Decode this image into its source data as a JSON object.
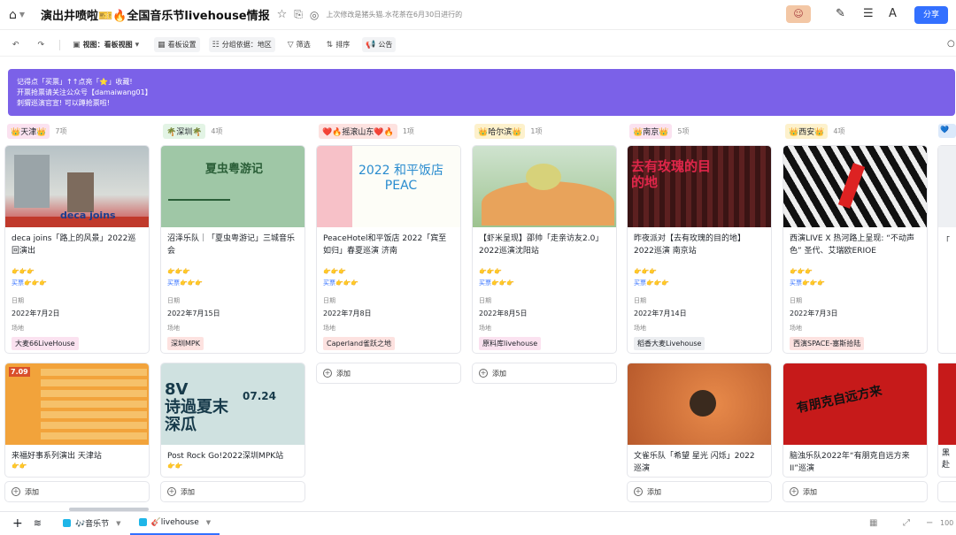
{
  "title_bar": {
    "doc_title": "演出井喷啦🎫🔥全国音乐节livehouse情报",
    "saved_text": "上次修改是猪头猫.水花茶在6月30日进行的",
    "share_label": "分享"
  },
  "toolbar": {
    "view_label": "视图：看板视图",
    "board_settings": "看板设置",
    "group_by": "分组依据：地区",
    "filter": "筛选",
    "sort": "排序",
    "notice": "公告"
  },
  "banner": {
    "lines": [
      "记得点「买票」↑↑点亮「⭐」收藏!",
      "开票抢票请关注公众号【damaiwang01】",
      "刺猬巡演官宣! 可以蹲抢票啦!"
    ]
  },
  "field_labels": {
    "date": "日期",
    "venue": "场地",
    "buy": "买票👉👉👉",
    "add": "添加"
  },
  "columns": [
    {
      "tag": "👑天津👑",
      "count": "7项",
      "tag_color": "#fbe2f0",
      "cards": [
        {
          "title": "deca joins「路上的风景」2022巡回演出",
          "date": "2022年7月2日",
          "venue": "大麦66LiveHouse",
          "venue_color": "#fbe2f0",
          "img": "deca joins"
        },
        {
          "title": "来福好事系列演出 天津站",
          "img": "7.09"
        }
      ]
    },
    {
      "tag": "🌴深圳🌴",
      "count": "4项",
      "tag_color": "#e3f4e5",
      "cards": [
        {
          "title": "沼泽乐队｜「夏虫粤游记」三城音乐会",
          "date": "2022年7月15日",
          "venue": "深圳MPK",
          "venue_color": "#fde2e0",
          "img": "夏虫粤游记"
        },
        {
          "title": "Post Rock Go!2022深圳MPK站",
          "img": "07.24"
        }
      ]
    },
    {
      "tag": "❤️🔥摇滚山东❤️🔥",
      "count": "1项",
      "tag_color": "#fde2e0",
      "cards": [
        {
          "title": "PeaceHotel和平饭店 2022「宾至如归」春夏巡演 济南",
          "date": "2022年7月8日",
          "venue": "Caperland雀跃之地",
          "venue_color": "#fde2e0",
          "img": "2022 和平饭店 PEAC"
        }
      ]
    },
    {
      "tag": "👑哈尔滨👑",
      "count": "1项",
      "tag_color": "#fdf1cc",
      "cards": [
        {
          "title": "【虾米呈现】邵帅「走亲访友2.0」2022巡演沈阳站",
          "date": "2022年8月5日",
          "venue": "原料库livehouse",
          "venue_color": "#fbe2f0",
          "img": ""
        }
      ]
    },
    {
      "tag": "👑南京👑",
      "count": "5项",
      "tag_color": "#fbe2f0",
      "cards": [
        {
          "title": "昨夜派对【去有玫瑰的目的地】2022巡演 南京站",
          "date": "2022年7月14日",
          "venue": "稻香大麦Livehouse",
          "venue_color": "#eceef1",
          "img": "去有玫瑰的目的地"
        },
        {
          "title": "文雀乐队「希望 星光 闪烁」2022 巡演",
          "img": ""
        }
      ]
    },
    {
      "tag": "👑西安👑",
      "count": "4项",
      "tag_color": "#fdf1cc",
      "cards": [
        {
          "title": "西演LIVE X 热河路上呈现: “不动声色” 圣代、艾瑞欧ERIOE",
          "date": "2022年7月3日",
          "venue": "西演SPACE-塞斯拾陆",
          "venue_color": "#fde2e0",
          "img": ""
        },
        {
          "title": "脑浊乐队2022年“有朋克自远方来II”巡演",
          "img": "有朋克自远方来"
        }
      ]
    }
  ],
  "partial_column": {
    "tag": "💙",
    "title_a": "「",
    "title_b": "黑",
    "title_c": "赴"
  },
  "bottom": {
    "tabs": [
      {
        "label": "🎶音乐节"
      },
      {
        "label": "🎸livehouse"
      }
    ],
    "zoom": "100"
  },
  "colors": {
    "accent": "#3370ff",
    "banner": "#7b61e8"
  }
}
